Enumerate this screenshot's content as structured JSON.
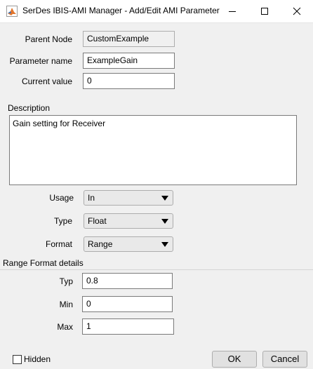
{
  "window": {
    "title": "SerDes IBIS-AMI Manager - Add/Edit AMI Parameter",
    "icon": "matlab-logo-icon",
    "controls": [
      "minimize-icon",
      "maximize-icon",
      "close-icon"
    ]
  },
  "form": {
    "parent_node": {
      "label": "Parent Node",
      "value": "CustomExample"
    },
    "parameter_name": {
      "label": "Parameter name",
      "value": "ExampleGain"
    },
    "current_value": {
      "label": "Current value",
      "value": "0"
    },
    "description": {
      "label": "Description",
      "value": "Gain setting for Receiver"
    },
    "usage": {
      "label": "Usage",
      "value": "In"
    },
    "type": {
      "label": "Type",
      "value": "Float"
    },
    "format": {
      "label": "Format",
      "value": "Range"
    }
  },
  "range_details": {
    "heading": "Range Format details",
    "typ": {
      "label": "Typ",
      "value": "0.8"
    },
    "min": {
      "label": "Min",
      "value": "0"
    },
    "max": {
      "label": "Max",
      "value": "1"
    }
  },
  "footer": {
    "hidden_label": "Hidden",
    "hidden_checked": false,
    "ok_label": "OK",
    "cancel_label": "Cancel"
  }
}
